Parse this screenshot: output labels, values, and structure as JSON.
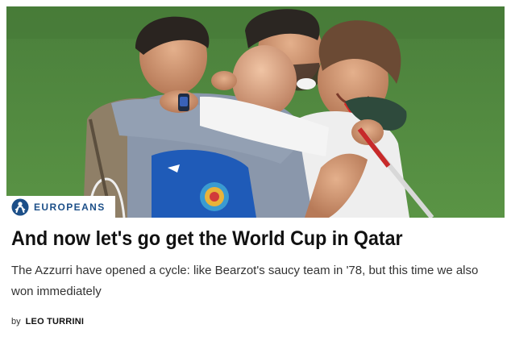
{
  "article": {
    "category": "EUROPEANS",
    "category_icon": "football-player-icon",
    "headline": "And now let's go get the World Cup in Qatar",
    "standfirst": "The Azzurri have opened a cycle: like Bearzot's saucy team in '78, but this time we also won immediately",
    "byline_prefix": "by",
    "author": "LEO TURRINI"
  },
  "colors": {
    "accent": "#1c4f88",
    "headline": "#111111",
    "body_text": "#333333"
  }
}
